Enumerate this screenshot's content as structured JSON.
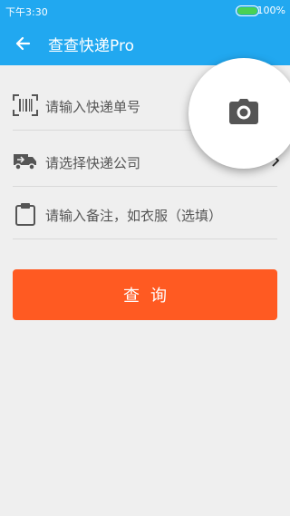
{
  "status": {
    "time": "下午3:30",
    "battery": "100%",
    "battery_level": 1.0
  },
  "header": {
    "title": "查查快递Pro",
    "back_icon": "arrow-left-icon"
  },
  "form": {
    "tracking_placeholder": "请输入快递单号",
    "company_placeholder": "请选择快递公司",
    "note_placeholder": "请输入备注，如衣服（选填）"
  },
  "actions": {
    "query_label": "查询"
  },
  "colors": {
    "primary": "#21a8f0",
    "accent": "#ff5a22",
    "icon": "#555555"
  },
  "icons": [
    "barcode-icon",
    "truck-icon",
    "clipboard-icon",
    "camera-icon",
    "chevron-right-icon"
  ]
}
